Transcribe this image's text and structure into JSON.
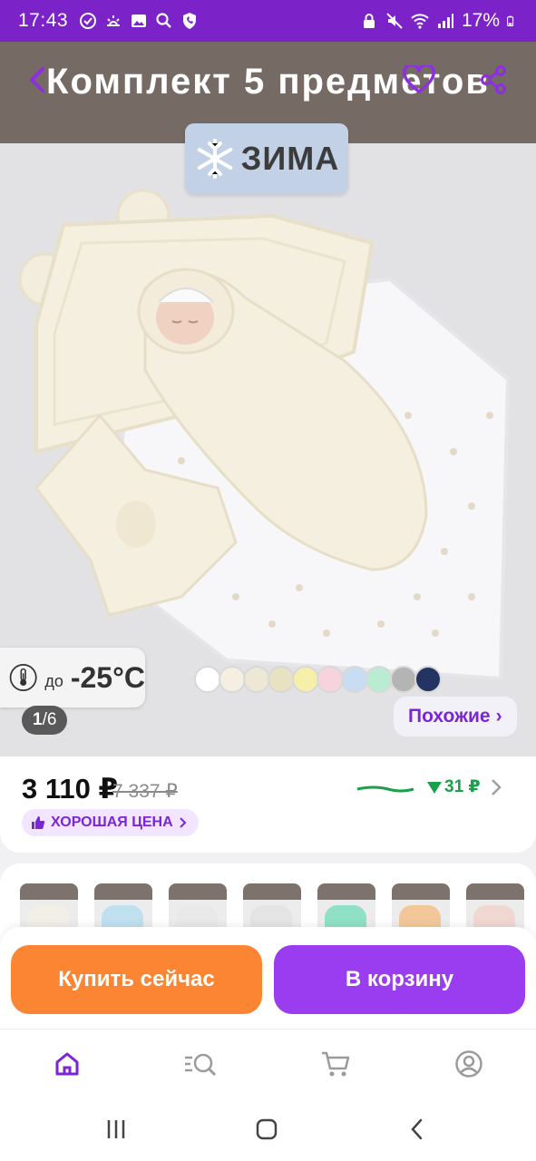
{
  "status_bar": {
    "time": "17:43",
    "battery": "17%"
  },
  "product": {
    "title": "Комплект 5 предметов",
    "season_label": "ЗИМА",
    "temperature_prefix": "до",
    "temperature_value": "-25°C",
    "color_swatches": [
      "#ffffff",
      "#f5efe2",
      "#ede7d6",
      "#e8e1c2",
      "#f6efa9",
      "#f7d4dc",
      "#c8dcf2",
      "#b9ecd3",
      "#b4b4b4",
      "#243462"
    ],
    "photo_counter_current": "1",
    "photo_counter_total": "6",
    "similar_label": "Похожие",
    "similar_chevron": "›"
  },
  "price": {
    "current": "3 110 ₽",
    "old": "7 337 ₽",
    "drop": "31 ₽",
    "drop_color": "#18a14a",
    "good_price_label": "ХОРОШАЯ ЦЕНА"
  },
  "variants": {
    "colors": [
      "#f2efe7",
      "#bfe0ef",
      "#e9e9e9",
      "#e4e4e4",
      "#8fe0c6",
      "#f2c79a",
      "#f1d7d2"
    ]
  },
  "actions": {
    "buy_now": "Купить сейчас",
    "add_to_cart": "В корзину"
  },
  "bottom_nav": {
    "items": [
      "home-icon",
      "catalog-search-icon",
      "cart-icon",
      "profile-icon"
    ],
    "active": "home-icon",
    "accent": "#7a26d6"
  },
  "colors": {
    "status_bar": "#7b22c9",
    "buy_button": "#fb8532",
    "cart_button": "#9a3cf0"
  }
}
